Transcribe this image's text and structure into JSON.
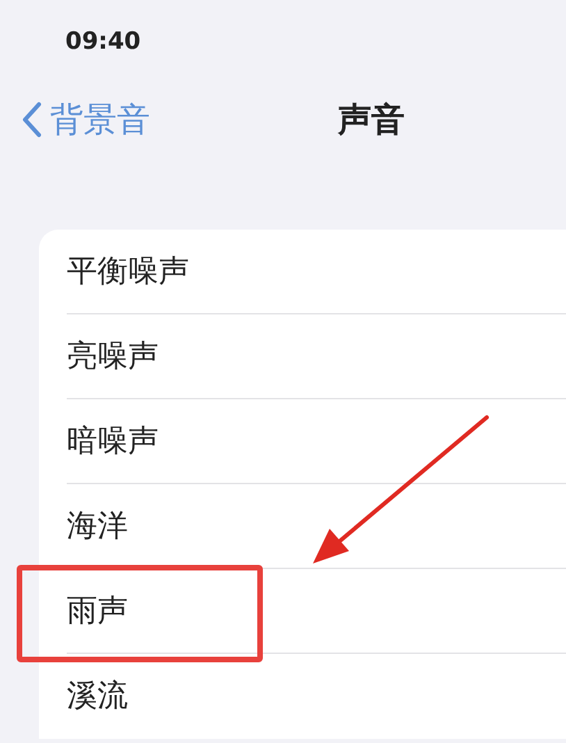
{
  "status_bar": {
    "time": "09:40"
  },
  "nav": {
    "back_label": "背景音",
    "title": "声音"
  },
  "items": [
    {
      "label": "平衡噪声",
      "highlighted": false
    },
    {
      "label": "亮噪声",
      "highlighted": false
    },
    {
      "label": "暗噪声",
      "highlighted": false
    },
    {
      "label": "海洋",
      "highlighted": false
    },
    {
      "label": "雨声",
      "highlighted": true
    },
    {
      "label": "溪流",
      "highlighted": false
    }
  ]
}
